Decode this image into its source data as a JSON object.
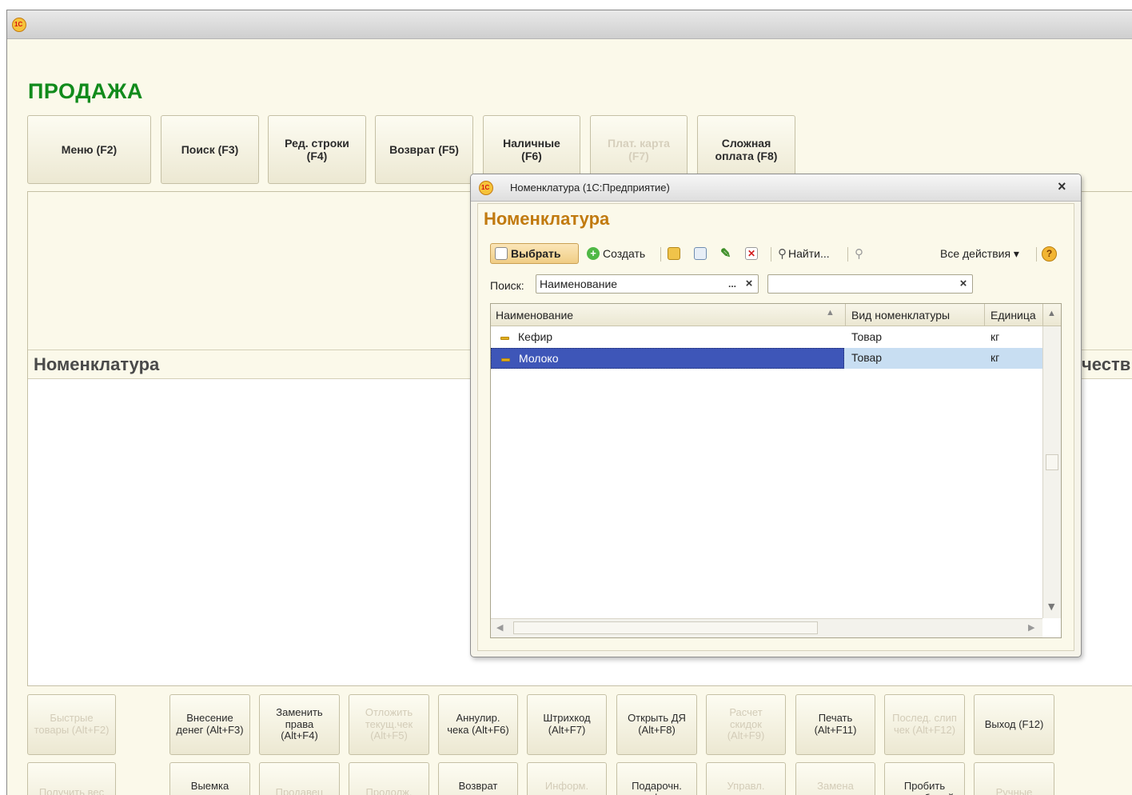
{
  "app": {
    "page_title": "ПРОДАЖА"
  },
  "top_buttons": [
    {
      "label": "Меню (F2)",
      "enabled": true
    },
    {
      "label": "Поиск (F3)",
      "enabled": true
    },
    {
      "label": "Ред. строки\n(F4)",
      "enabled": true
    },
    {
      "label": "Возврат (F5)",
      "enabled": true
    },
    {
      "label": "Наличные\n(F6)",
      "enabled": true
    },
    {
      "label": "Плат. карта\n(F7)",
      "enabled": false
    },
    {
      "label": "Сложная\nоплата (F8)",
      "enabled": true
    }
  ],
  "panel": {
    "left_header": "Номенклатура",
    "right_header_partial": "честв"
  },
  "bottom_row1": [
    {
      "label": "Быстрые\nтовары (Alt+F2)",
      "enabled": false
    },
    {
      "label": "Внесение\nденег (Alt+F3)",
      "enabled": true
    },
    {
      "label": "Заменить\nправа\n(Alt+F4)",
      "enabled": true
    },
    {
      "label": "Отложить\nтекущ.чек\n(Alt+F5)",
      "enabled": false
    },
    {
      "label": "Аннулир.\nчека (Alt+F6)",
      "enabled": true
    },
    {
      "label": "Штрихкод\n(Alt+F7)",
      "enabled": true
    },
    {
      "label": "Открыть ДЯ\n(Alt+F8)",
      "enabled": true
    },
    {
      "label": "Расчет\nскидок\n(Alt+F9)",
      "enabled": false
    },
    {
      "label": "Печать\n(Alt+F11)",
      "enabled": true
    },
    {
      "label": "Послед. слип\nчек (Alt+F12)",
      "enabled": false
    },
    {
      "label": "Выход (F12)",
      "enabled": true
    }
  ],
  "bottom_row2": [
    {
      "label": "Получить вес",
      "enabled": false
    },
    {
      "label": "Выемка\nденег",
      "enabled": true
    },
    {
      "label": "Продавец",
      "enabled": false
    },
    {
      "label": "Продолж.",
      "enabled": false
    },
    {
      "label": "Возврат\nпокупателя",
      "enabled": true
    },
    {
      "label": "Информ.\nкарта",
      "enabled": false
    },
    {
      "label": "Подарочн.\nсертификаты",
      "enabled": true
    },
    {
      "label": "Управл.\nскидки",
      "enabled": false
    },
    {
      "label": "Замена\nкарты",
      "enabled": false
    },
    {
      "label": "Пробить\nнепробитый",
      "enabled": true
    },
    {
      "label": "Ручные",
      "enabled": false
    }
  ],
  "dialog": {
    "title": "Номенклатура  (1С:Предприятие)",
    "close": "×",
    "heading": "Номенклатура",
    "toolbar": {
      "select": "Выбрать",
      "create": "Создать",
      "find": "Найти...",
      "all_actions": "Все действия ▾",
      "help": "?"
    },
    "search": {
      "label": "Поиск:",
      "field": "Наименование",
      "ellipsis": "...",
      "clear": "×",
      "value": "",
      "clear2": "×"
    },
    "columns": [
      "Наименование",
      "Вид номенклатуры",
      "Единица"
    ],
    "rows": [
      {
        "name": "Кефир",
        "kind": "Товар",
        "unit": "кг",
        "selected": false
      },
      {
        "name": "Молоко",
        "kind": "Товар",
        "unit": "кг",
        "selected": true
      }
    ]
  },
  "colors": {
    "title_green": "#118b1c",
    "dialog_heading": "#c17a0f",
    "selection": "#3e56b8",
    "row_highlight": "#c8def2"
  }
}
